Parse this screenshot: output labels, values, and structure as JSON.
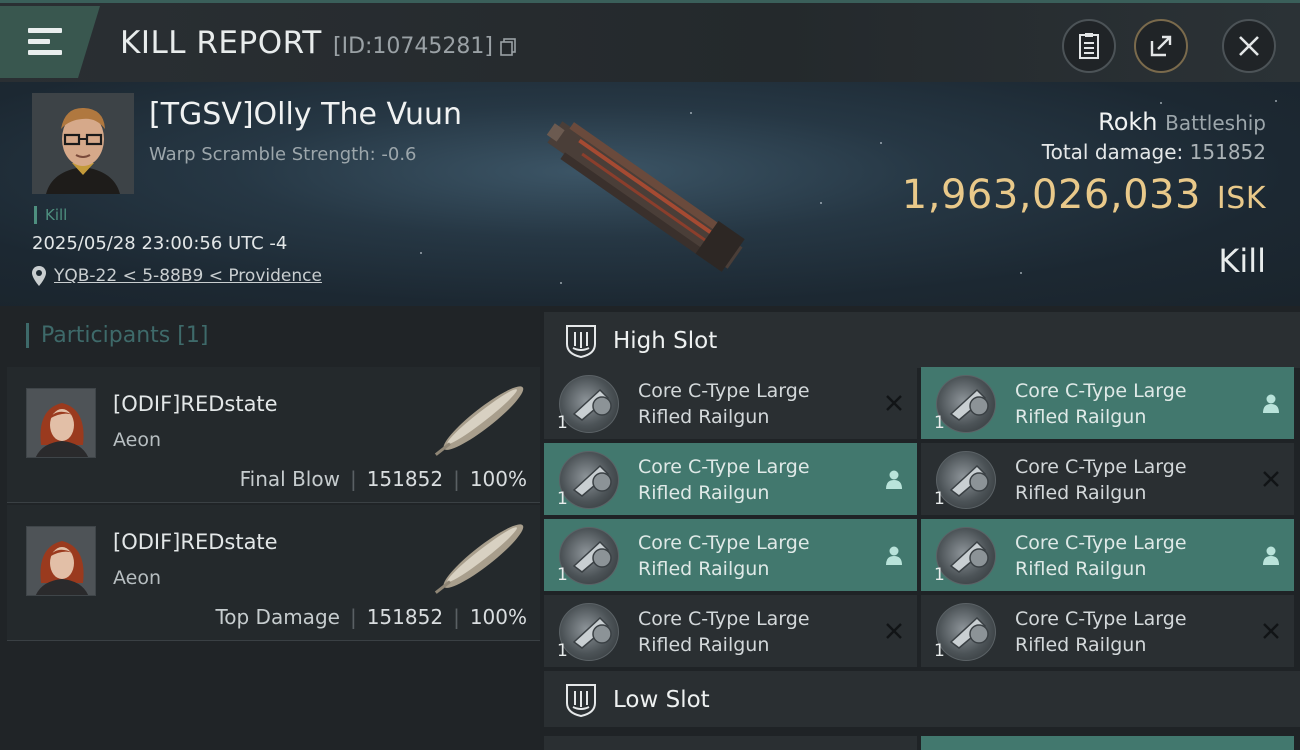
{
  "header": {
    "title": "KILL REPORT",
    "report_id": "[ID:10745281]"
  },
  "victim": {
    "name": "[TGSV]Olly The Vuun",
    "warp_scramble": "Warp Scramble Strength: -0.6",
    "tag": "Kill",
    "datetime": "2025/05/28 23:00:56 UTC -4",
    "location": "YQB-22 < 5-88B9 < Providence"
  },
  "ship": {
    "name": "Rokh",
    "class": "Battleship",
    "total_damage_label": "Total damage:",
    "total_damage": "151852",
    "isk_value": "1,963,026,033",
    "isk_unit": "ISK",
    "result": "Kill"
  },
  "participants": {
    "header": "Participants",
    "count": "[1]",
    "rows": [
      {
        "name": "[ODIF]REDstate",
        "ship": "Aeon",
        "role": "Final Blow",
        "damage": "151852",
        "percent": "100%"
      },
      {
        "name": "[ODIF]REDstate",
        "ship": "Aeon",
        "role": "Top Damage",
        "damage": "151852",
        "percent": "100%"
      }
    ]
  },
  "fitting": {
    "high_slot_label": "High Slot",
    "low_slot_label": "Low Slot",
    "high_slots": [
      {
        "name": "Core C-Type Large Rifled Railgun",
        "qty": "1",
        "state": "destroyed",
        "active": false
      },
      {
        "name": "Core C-Type Large Rifled Railgun",
        "qty": "1",
        "state": "dropped",
        "active": true
      },
      {
        "name": "Core C-Type Large Rifled Railgun",
        "qty": "1",
        "state": "dropped",
        "active": true
      },
      {
        "name": "Core C-Type Large Rifled Railgun",
        "qty": "1",
        "state": "destroyed",
        "active": false
      },
      {
        "name": "Core C-Type Large Rifled Railgun",
        "qty": "1",
        "state": "dropped",
        "active": true
      },
      {
        "name": "Core C-Type Large Rifled Railgun",
        "qty": "1",
        "state": "dropped",
        "active": true
      },
      {
        "name": "Core C-Type Large Rifled Railgun",
        "qty": "1",
        "state": "destroyed",
        "active": false
      },
      {
        "name": "Core C-Type Large Rifled Railgun",
        "qty": "1",
        "state": "destroyed",
        "active": false
      }
    ]
  },
  "colors": {
    "accent_teal": "#42786e",
    "isk_gold": "#e9c98a",
    "kill_tag": "#4e8f7f"
  }
}
